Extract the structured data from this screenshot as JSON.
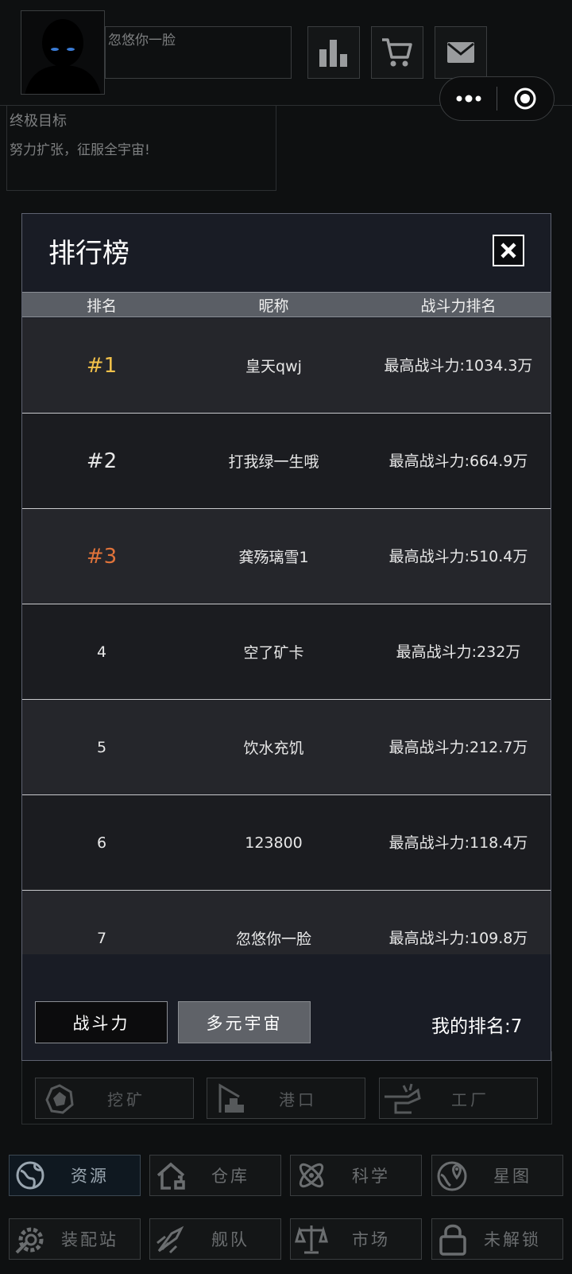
{
  "header": {
    "player_name": "忽悠你一脸"
  },
  "goal": {
    "title": "终极目标",
    "description": "努力扩张，征服全宇宙!"
  },
  "modal": {
    "title": "排行榜",
    "columns": [
      "排名",
      "昵称",
      "战斗力排名"
    ],
    "rows": [
      {
        "rank": "#1",
        "nickname": "皇天qwj",
        "power": "最高战斗力:1034.3万",
        "rank_color": "#f2c14a"
      },
      {
        "rank": "#2",
        "nickname": "打我绿一生哦",
        "power": "最高战斗力:664.9万",
        "rank_color": "#e8e8e8"
      },
      {
        "rank": "#3",
        "nickname": "龚殇璃雪1",
        "power": "最高战斗力:510.4万",
        "rank_color": "#e0733a"
      },
      {
        "rank": "4",
        "nickname": "空了矿卡",
        "power": "最高战斗力:232万",
        "rank_color": "#e8e8e8"
      },
      {
        "rank": "5",
        "nickname": "饮水充饥",
        "power": "最高战斗力:212.7万",
        "rank_color": "#e8e8e8"
      },
      {
        "rank": "6",
        "nickname": "123800",
        "power": "最高战斗力:118.4万",
        "rank_color": "#e8e8e8"
      },
      {
        "rank": "7",
        "nickname": "忽悠你一脸",
        "power": "最高战斗力:109.8万",
        "rank_color": "#e8e8e8"
      }
    ],
    "tab_power": "战斗力",
    "tab_multiverse": "多元宇宙",
    "my_rank": "我的排名:7"
  },
  "factory_buttons": [
    {
      "label": "挖矿",
      "icon": "mining-icon"
    },
    {
      "label": "港口",
      "icon": "port-icon"
    },
    {
      "label": "工厂",
      "icon": "factory-icon"
    }
  ],
  "nav": [
    {
      "label": "资源",
      "icon": "globe-icon"
    },
    {
      "label": "仓库",
      "icon": "house-icon"
    },
    {
      "label": "科学",
      "icon": "atom-icon"
    },
    {
      "label": "星图",
      "icon": "map-pin-icon"
    },
    {
      "label": "装配站",
      "icon": "gear-wrench-icon"
    },
    {
      "label": "舰队",
      "icon": "ship-icon"
    },
    {
      "label": "市场",
      "icon": "scales-icon"
    },
    {
      "label": "未解锁",
      "icon": "lock-icon"
    }
  ]
}
